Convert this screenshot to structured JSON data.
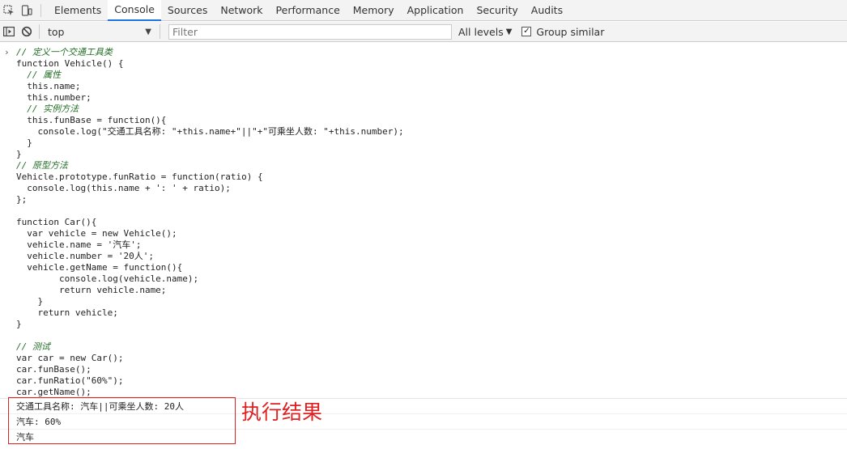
{
  "tabs": [
    "Elements",
    "Console",
    "Sources",
    "Network",
    "Performance",
    "Memory",
    "Application",
    "Security",
    "Audits"
  ],
  "active_tab": "Console",
  "toolbar": {
    "context": "top",
    "filter_placeholder": "Filter",
    "levels": "All levels",
    "group_similar": "Group similar"
  },
  "code_lines": [
    "// 定义一个交通工具类",
    "function Vehicle() {",
    "  // 属性",
    "  this.name;",
    "  this.number;",
    "  // 实例方法",
    "  this.funBase = function(){",
    "    console.log(\"交通工具名称: \"+this.name+\"||\"+\"可乘坐人数: \"+this.number);",
    "  }",
    "}",
    "// 原型方法",
    "Vehicle.prototype.funRatio = function(ratio) {",
    "  console.log(this.name + ': ' + ratio);",
    "};",
    "",
    "function Car(){",
    "  var vehicle = new Vehicle();",
    "  vehicle.name = '汽车';",
    "  vehicle.number = '20人';",
    "  vehicle.getName = function(){",
    "        console.log(vehicle.name);",
    "        return vehicle.name;",
    "    }",
    "    return vehicle;",
    "}",
    "",
    "// 测试",
    "var car = new Car();",
    "car.funBase();",
    "car.funRatio(\"60%\");",
    "car.getName();"
  ],
  "output_lines": [
    "交通工具名称: 汽车||可乘坐人数: 20人",
    "汽车: 60%",
    "汽车"
  ],
  "annotation": "执行结果",
  "colors": {
    "keyword": "#aa0d91",
    "comment": "#236e25",
    "string": "#c41a16",
    "annotation": "#e02020",
    "active_tab_underline": "#1a73e8"
  }
}
